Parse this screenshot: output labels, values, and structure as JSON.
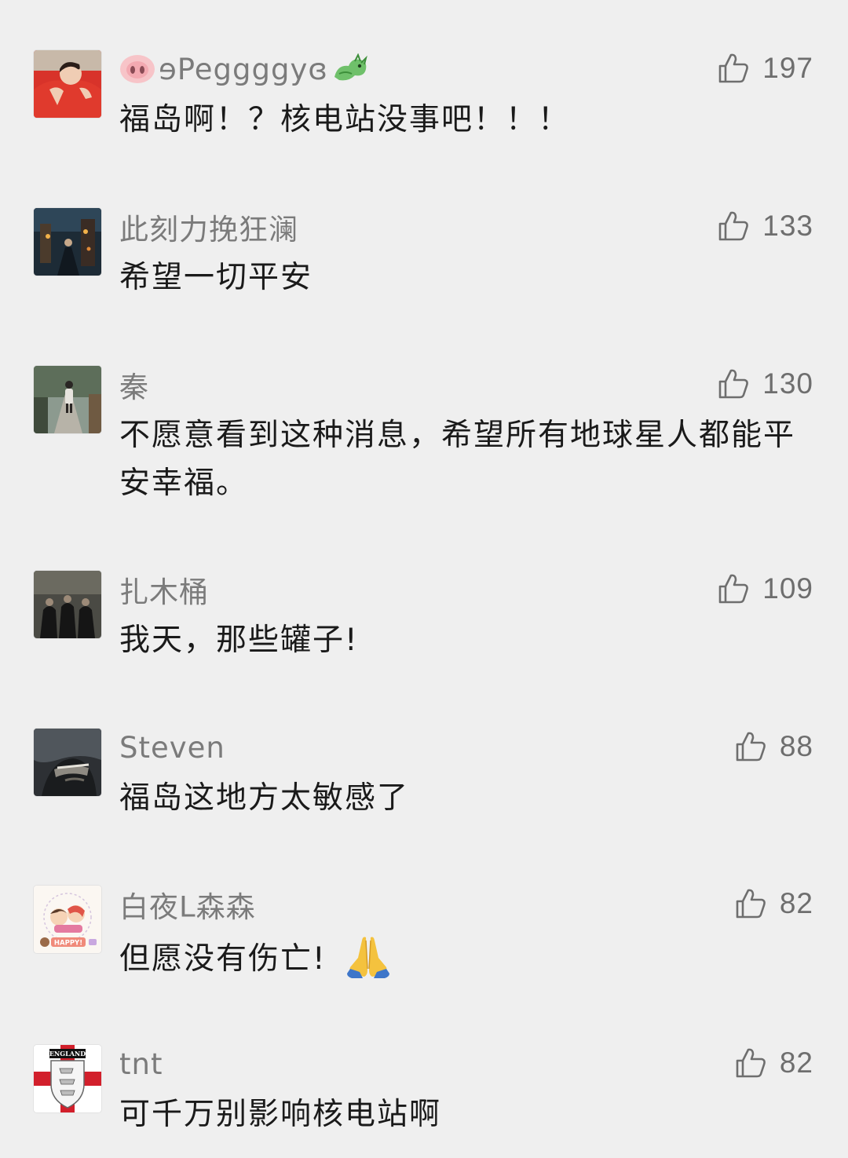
{
  "comments": [
    {
      "name": "ɘPeggggyɞ",
      "likes": "197",
      "text": "福岛啊！？核电站没事吧！！！",
      "name_prefix_icon": "pig-nose-emoji-icon",
      "name_suffix_icon": "dragon-emoji-icon"
    },
    {
      "name": "此刻力挽狂澜",
      "likes": "133",
      "text": "希望一切平安"
    },
    {
      "name": "秦",
      "likes": "130",
      "text": "不愿意看到这种消息，希望所有地球星人都能平安幸福。"
    },
    {
      "name": "扎木桶",
      "likes": "109",
      "text": "我天，那些罐子!"
    },
    {
      "name": "Steven",
      "likes": "88",
      "text": "福岛这地方太敏感了"
    },
    {
      "name": "白夜ᒪ森森",
      "likes": "82",
      "text": "但愿没有伤亡!",
      "text_suffix_icon": "folded-hands-emoji-icon"
    },
    {
      "name": "tnt",
      "likes": "82",
      "text": "可千万别影响核电站啊",
      "avatar_text": "ENGLAND"
    }
  ],
  "avatar_badge_text": "HAPPY!",
  "colors": {
    "background": "#efefef",
    "name": "#7b7b7b",
    "text": "#1a1a1a",
    "like": "#6e6e6e"
  }
}
